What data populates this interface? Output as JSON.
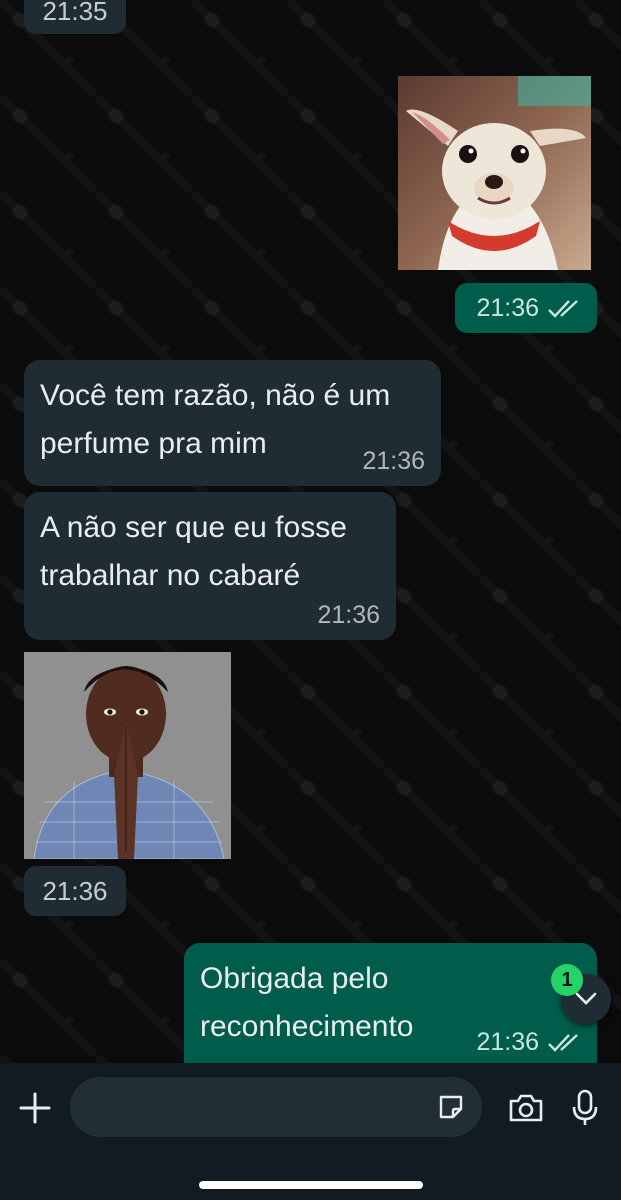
{
  "chat": {
    "top_timestamp": "21:35",
    "messages": [
      {
        "id": "dog-image",
        "direction": "out",
        "type": "image",
        "image_desc": "smiling chihuahua dog with red collar",
        "time": "21:36",
        "read": true
      },
      {
        "id": "msg-1",
        "direction": "in",
        "type": "text",
        "text": "Você tem razão, não é um\nperfume pra mim",
        "time": "21:36"
      },
      {
        "id": "msg-2",
        "direction": "in",
        "type": "text",
        "text": "A não ser que eu fosse\ntrabalhar no cabaré",
        "time": "21:36"
      },
      {
        "id": "man-image",
        "direction": "in",
        "type": "image",
        "image_desc": "man with hands pressed together in prayer",
        "time": "21:36"
      },
      {
        "id": "msg-3",
        "direction": "out",
        "type": "text",
        "text": "Obrigada pelo\nreconhecimento",
        "time": "21:36",
        "read": true
      }
    ],
    "unread_count": "1"
  },
  "input_bar": {
    "icons": [
      "plus-icon",
      "sticker-icon",
      "camera-icon",
      "microphone-icon"
    ]
  },
  "colors": {
    "background": "#0b0b0b",
    "incoming_bubble": "#202c33",
    "outgoing_bubble": "#005c4b",
    "read_checks": "#c7e7df",
    "badge": "#25d366"
  }
}
